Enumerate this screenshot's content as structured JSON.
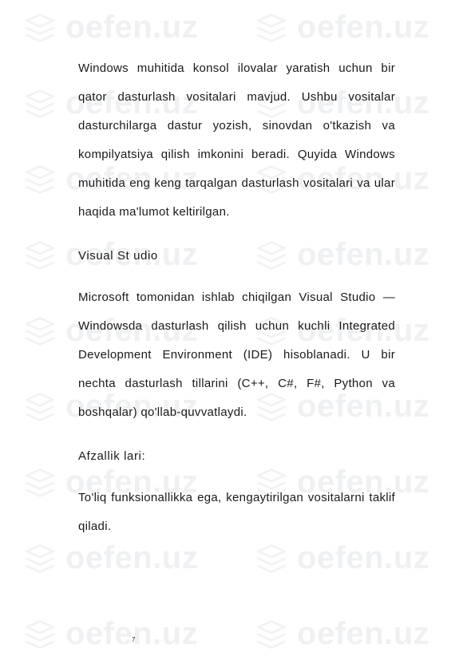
{
  "watermark": {
    "text": "oefen.uz"
  },
  "body": {
    "p1": "Windows muhitida konsol ilovalar yaratish uchun bir qator dasturlash vositalari mavjud. Ushbu vositalar dasturchilarga dastur yozish, sinovdan o'tkazish va kompilyatsiya qilish imkonini beradi. Quyida Windows muhitida eng keng tarqalgan dasturlash vositalari va ular haqida ma'lumot keltirilgan.",
    "h1": "Visual St udio",
    "p2": "Microsoft tomonidan ishlab chiqilgan Visual Studio — Windowsda dasturlash qilish uchun kuchli Integrated Development Environment (IDE) hisoblanadi. U bir nechta dasturlash tillarini (C++, C#, F#, Python va boshqalar) qo'llab-quvvatlaydi.",
    "h2": "Afzallik lari:",
    "p3": "To'liq funksionallikka ega, kengaytirilgan vositalarni taklif qiladi."
  },
  "page_number": "7"
}
